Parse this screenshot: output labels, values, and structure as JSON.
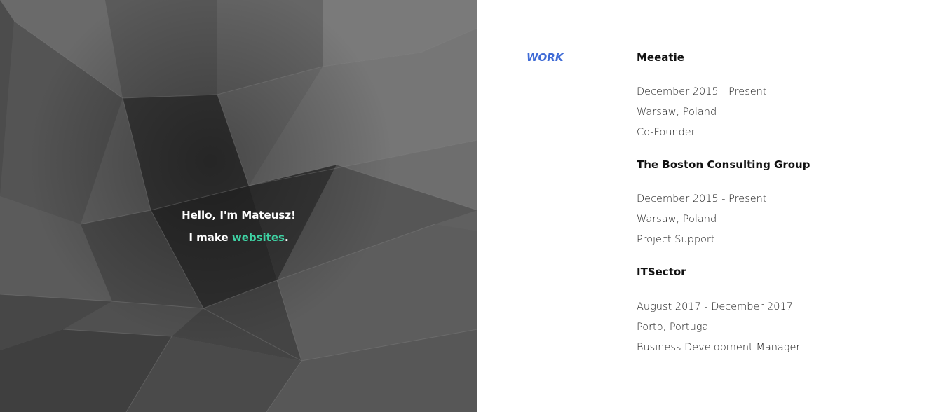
{
  "hero": {
    "greeting": "Hello, I'm Mateusz!",
    "tagline_prefix": "I make ",
    "tagline_highlight": "websites",
    "tagline_suffix": ".",
    "accent_color": "#3ed3a4",
    "background_color": "#5f5f5f"
  },
  "section": {
    "label": "WORK",
    "label_color": "#3f6bd6"
  },
  "jobs": [
    {
      "company": "Meeatie",
      "period": "December 2015 - Present",
      "location": "Warsaw, Poland",
      "role": "Co-Founder"
    },
    {
      "company": "The Boston Consulting Group",
      "period": "December 2015 - Present",
      "location": "Warsaw, Poland",
      "role": "Project Support"
    },
    {
      "company": "ITSector",
      "period": "August 2017 - December 2017",
      "location": "Porto, Portugal",
      "role": "Business Development Manager"
    }
  ]
}
